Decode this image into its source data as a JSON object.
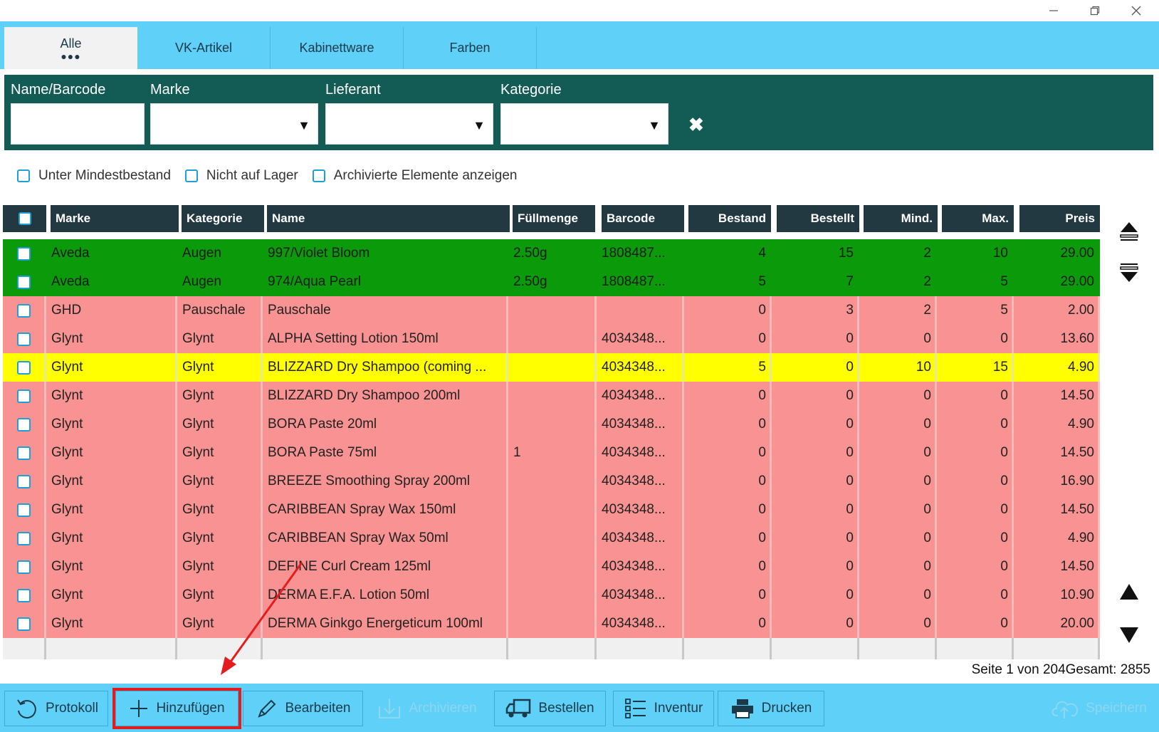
{
  "window": {
    "minimize": "—",
    "restore": "❐",
    "close": "✕"
  },
  "tabs": [
    {
      "label": "Alle",
      "dots": "●●●",
      "active": true
    },
    {
      "label": "VK-Artikel"
    },
    {
      "label": "Kabinettware"
    },
    {
      "label": "Farben"
    }
  ],
  "filters": {
    "name_label": "Name/Barcode",
    "name_value": "",
    "brand_label": "Marke",
    "brand_value": "",
    "supplier_label": "Lieferant",
    "supplier_value": "",
    "category_label": "Kategorie",
    "category_value": "",
    "dropdown_glyph": "▼",
    "clear_glyph": "✖"
  },
  "options": [
    {
      "label": "Unter Mindestbestand",
      "checked": false
    },
    {
      "label": "Nicht auf Lager",
      "checked": false
    },
    {
      "label": "Archivierte Elemente anzeigen",
      "checked": false
    }
  ],
  "columns": {
    "marke": "Marke",
    "kategorie": "Kategorie",
    "name": "Name",
    "fuellmenge": "Füllmenge",
    "barcode": "Barcode",
    "bestand": "Bestand",
    "bestellt": "Bestellt",
    "mind": "Mind.",
    "max": "Max.",
    "preis": "Preis"
  },
  "rows": [
    {
      "status": "green",
      "marke": "Aveda",
      "kategorie": "Augen",
      "name": "997/Violet Bloom",
      "fuellmenge": "2.50g",
      "barcode": "1808487...",
      "bestand": "4",
      "bestellt": "15",
      "mind": "2",
      "max": "10",
      "preis": "29.00"
    },
    {
      "status": "green",
      "marke": "Aveda",
      "kategorie": "Augen",
      "name": "974/Aqua Pearl",
      "fuellmenge": "2.50g",
      "barcode": "1808487...",
      "bestand": "5",
      "bestellt": "7",
      "mind": "2",
      "max": "5",
      "preis": "29.00"
    },
    {
      "status": "red",
      "marke": "GHD",
      "kategorie": "Pauschale",
      "name": "Pauschale",
      "fuellmenge": "",
      "barcode": "",
      "bestand": "0",
      "bestellt": "3",
      "mind": "2",
      "max": "5",
      "preis": "2.00"
    },
    {
      "status": "red",
      "marke": "Glynt",
      "kategorie": "Glynt",
      "name": "ALPHA Setting Lotion 150ml",
      "fuellmenge": "",
      "barcode": "4034348...",
      "bestand": "0",
      "bestellt": "0",
      "mind": "0",
      "max": "0",
      "preis": "13.60"
    },
    {
      "status": "yellow",
      "marke": "Glynt",
      "kategorie": "Glynt",
      "name": "BLIZZARD Dry Shampoo (coming ...",
      "fuellmenge": "",
      "barcode": "4034348...",
      "bestand": "5",
      "bestellt": "0",
      "mind": "10",
      "max": "15",
      "preis": "4.90"
    },
    {
      "status": "red",
      "marke": "Glynt",
      "kategorie": "Glynt",
      "name": "BLIZZARD Dry Shampoo 200ml",
      "fuellmenge": "",
      "barcode": "4034348...",
      "bestand": "0",
      "bestellt": "0",
      "mind": "0",
      "max": "0",
      "preis": "14.50"
    },
    {
      "status": "red",
      "marke": "Glynt",
      "kategorie": "Glynt",
      "name": "BORA Paste 20ml",
      "fuellmenge": "",
      "barcode": "4034348...",
      "bestand": "0",
      "bestellt": "0",
      "mind": "0",
      "max": "0",
      "preis": "4.90"
    },
    {
      "status": "red",
      "marke": "Glynt",
      "kategorie": "Glynt",
      "name": "BORA Paste 75ml",
      "fuellmenge": "1",
      "barcode": "4034348...",
      "bestand": "0",
      "bestellt": "0",
      "mind": "0",
      "max": "0",
      "preis": "14.50"
    },
    {
      "status": "red",
      "marke": "Glynt",
      "kategorie": "Glynt",
      "name": "BREEZE Smoothing Spray 200ml",
      "fuellmenge": "",
      "barcode": "4034348...",
      "bestand": "0",
      "bestellt": "0",
      "mind": "0",
      "max": "0",
      "preis": "16.90"
    },
    {
      "status": "red",
      "marke": "Glynt",
      "kategorie": "Glynt",
      "name": "CARIBBEAN Spray Wax 150ml",
      "fuellmenge": "",
      "barcode": "4034348...",
      "bestand": "0",
      "bestellt": "0",
      "mind": "0",
      "max": "0",
      "preis": "14.50"
    },
    {
      "status": "red",
      "marke": "Glynt",
      "kategorie": "Glynt",
      "name": "CARIBBEAN Spray Wax 50ml",
      "fuellmenge": "",
      "barcode": "4034348...",
      "bestand": "0",
      "bestellt": "0",
      "mind": "0",
      "max": "0",
      "preis": "4.90"
    },
    {
      "status": "red",
      "marke": "Glynt",
      "kategorie": "Glynt",
      "name": "DEFINE Curl Cream 125ml",
      "fuellmenge": "",
      "barcode": "4034348...",
      "bestand": "0",
      "bestellt": "0",
      "mind": "0",
      "max": "0",
      "preis": "14.50"
    },
    {
      "status": "red",
      "marke": "Glynt",
      "kategorie": "Glynt",
      "name": "DERMA E.F.A. Lotion 50ml",
      "fuellmenge": "",
      "barcode": "4034348...",
      "bestand": "0",
      "bestellt": "0",
      "mind": "0",
      "max": "0",
      "preis": "10.90"
    },
    {
      "status": "red",
      "marke": "Glynt",
      "kategorie": "Glynt",
      "name": "DERMA Ginkgo Energeticum 100ml",
      "fuellmenge": "",
      "barcode": "4034348...",
      "bestand": "0",
      "bestellt": "0",
      "mind": "0",
      "max": "0",
      "preis": "20.00"
    }
  ],
  "pagination": {
    "text": "Seite 1 von 204Gesamt: 2855"
  },
  "side_icons": [
    "scroll-top-icon",
    "scroll-bottom-icon",
    "scroll-up-icon",
    "scroll-down-icon"
  ],
  "toolbar": {
    "protokoll": "Protokoll",
    "hinzufuegen": "Hinzufügen",
    "bearbeiten": "Bearbeiten",
    "archivieren": "Archivieren",
    "bestellen": "Bestellen",
    "inventur": "Inventur",
    "drucken": "Drucken",
    "speichern": "Speichern"
  },
  "colors": {
    "accent": "#5fd0f8",
    "filter_band": "#135c56",
    "header": "#223942",
    "row_green": "#0a9a0a",
    "row_red": "#f99292",
    "row_yellow": "#ffff00",
    "annotation": "#e31d1d"
  }
}
